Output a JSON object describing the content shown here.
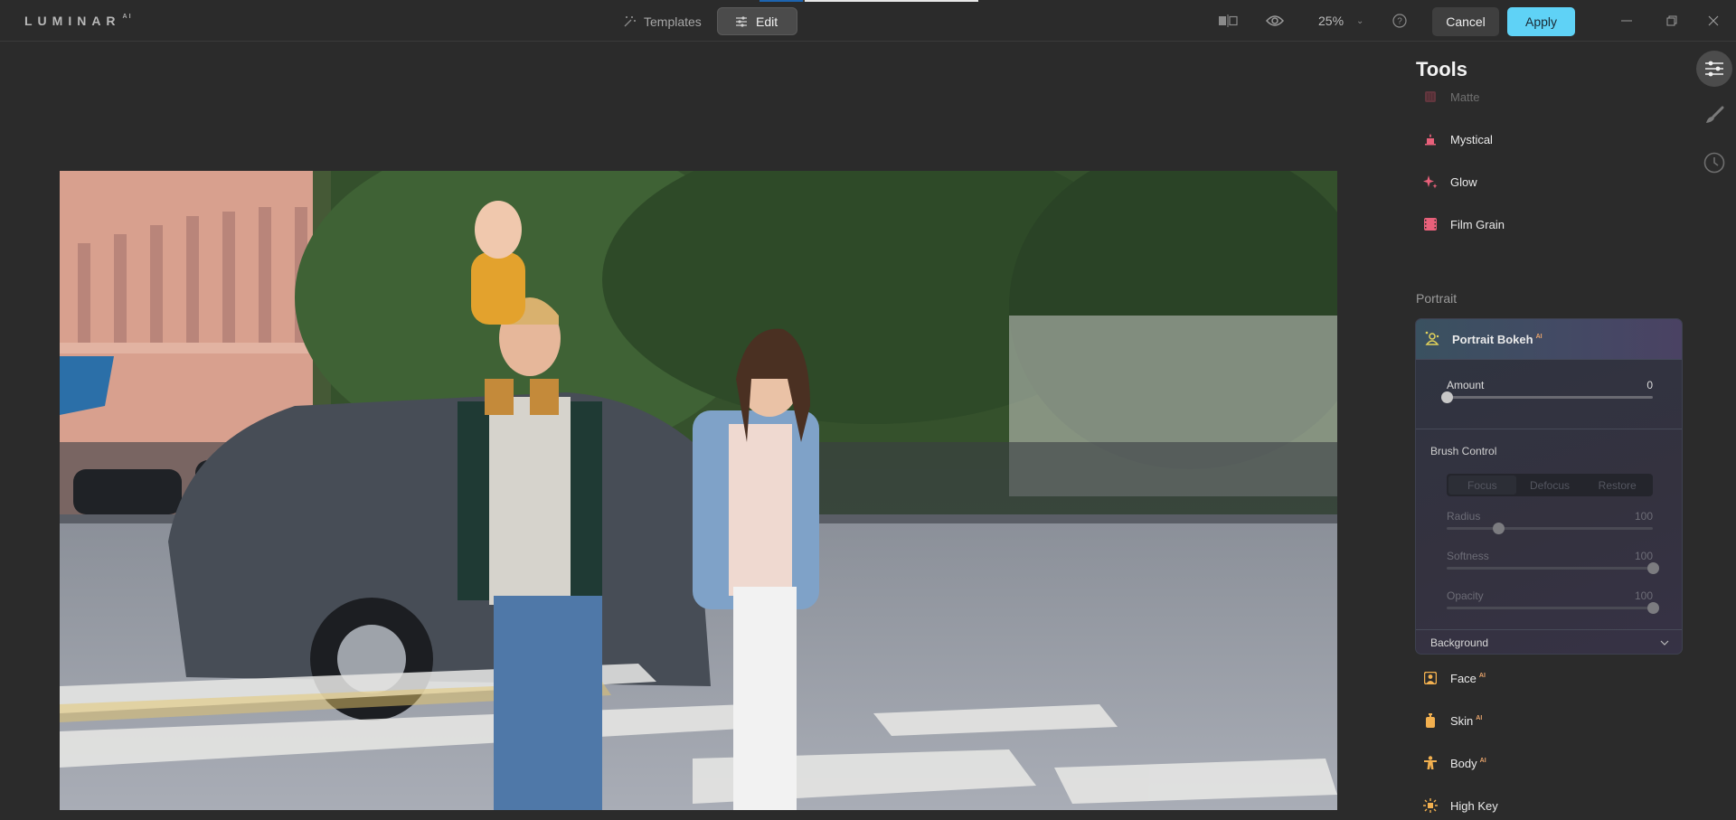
{
  "app": {
    "logo": "LUMINAR",
    "logo_sup": "AI"
  },
  "progress": {
    "fraction": 0.2
  },
  "mode_tabs": [
    {
      "label": "Templates",
      "icon": "magic-wand-icon",
      "active": false
    },
    {
      "label": "Edit",
      "icon": "sliders-icon",
      "active": true
    }
  ],
  "toolbar": {
    "compare_icon": "compare-icon",
    "preview_icon": "eye-icon",
    "zoom": "25%",
    "help_icon": "help-icon",
    "cancel_label": "Cancel",
    "apply_label": "Apply"
  },
  "window_controls": [
    "minimize",
    "restore",
    "close"
  ],
  "panel": {
    "title": "Tools",
    "tools_above": [
      {
        "label": "Matte",
        "icon": "matte-icon",
        "color": "#d9586c",
        "faded": true
      },
      {
        "label": "Mystical",
        "icon": "mystical-icon",
        "color": "#e8607a"
      },
      {
        "label": "Glow",
        "icon": "glow-icon",
        "color": "#e8607a"
      },
      {
        "label": "Film Grain",
        "icon": "film-grain-icon",
        "color": "#e8607a"
      }
    ],
    "section": "Portrait",
    "expanded_tool": {
      "label": "Portrait Bokeh",
      "ai_badge": "AI",
      "icon_color": "#e3d35a",
      "amount": {
        "label": "Amount",
        "value": "0",
        "fraction": 0
      },
      "brush_control": {
        "label": "Brush Control",
        "modes": [
          "Focus",
          "Defocus",
          "Restore"
        ],
        "active_mode": "Focus",
        "radius": {
          "label": "Radius",
          "value": "100",
          "fraction": 0.25
        },
        "softness": {
          "label": "Softness",
          "value": "100",
          "fraction": 1.0
        },
        "opacity": {
          "label": "Opacity",
          "value": "100",
          "fraction": 1.0
        }
      },
      "background": {
        "label": "Background"
      }
    },
    "tools_below": [
      {
        "label": "Face",
        "ai": "AI",
        "icon": "face-icon",
        "color": "#f2b04f"
      },
      {
        "label": "Skin",
        "ai": "AI",
        "icon": "skin-icon",
        "color": "#f2b04f"
      },
      {
        "label": "Body",
        "ai": "AI",
        "icon": "body-icon",
        "color": "#f2b04f"
      },
      {
        "label": "High Key",
        "ai": "",
        "icon": "high-key-icon",
        "color": "#f2b04f"
      }
    ]
  },
  "rail": [
    {
      "name": "edit-tools-icon",
      "active": true
    },
    {
      "name": "brush-icon",
      "active": false
    },
    {
      "name": "history-icon",
      "active": false
    }
  ]
}
